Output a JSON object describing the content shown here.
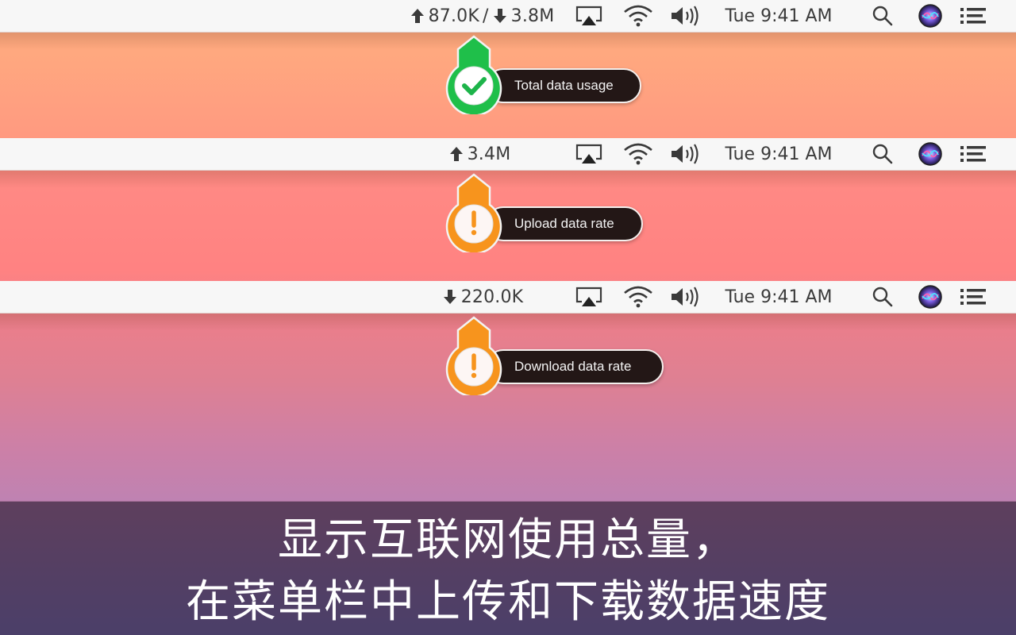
{
  "menubars": [
    {
      "id": "total",
      "netstat": {
        "up": "87.0K",
        "separator": "/",
        "down": "3.8M",
        "show_up": true,
        "show_down": true
      },
      "clock": "Tue 9:41 AM"
    },
    {
      "id": "upload",
      "netstat": {
        "up": "3.4M",
        "show_up": true,
        "show_down": false
      },
      "clock": "Tue 9:41 AM"
    },
    {
      "id": "download",
      "netstat": {
        "down": "220.0K",
        "show_up": false,
        "show_down": true
      },
      "clock": "Tue 9:41 AM"
    }
  ],
  "icons": {
    "airplay": "airplay-icon",
    "wifi": "wifi-icon",
    "volume": "volume-icon",
    "search": "search-icon",
    "siri": "siri-icon",
    "notification": "notification-center-icon",
    "up_arrow": "upload-arrow-icon",
    "down_arrow": "download-arrow-icon"
  },
  "callouts": [
    {
      "label": "Total data usage",
      "icon": "check-icon",
      "color": "#1db954"
    },
    {
      "label": "Upload data rate",
      "icon": "exclamation-icon",
      "color": "#f7941d"
    },
    {
      "label": "Download data rate",
      "icon": "exclamation-icon",
      "color": "#f7941d"
    }
  ],
  "caption": {
    "line1": "显示互联网使用总量，",
    "line2": "在菜单栏中上传和下载数据速度"
  }
}
